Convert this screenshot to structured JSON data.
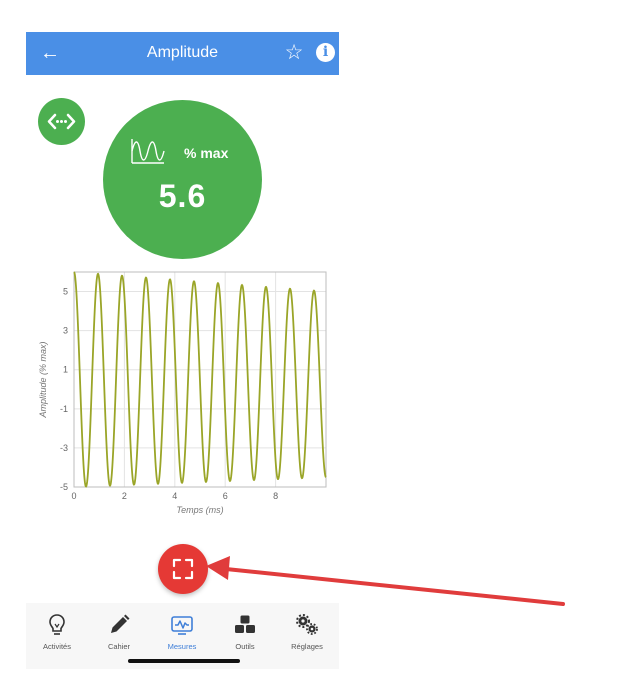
{
  "appbar": {
    "title": "Amplitude",
    "back_icon": "arrow-left-icon",
    "favorite_icon": "star-outline-icon",
    "info_icon": "info-icon",
    "color": "#4a8fe6"
  },
  "gauge": {
    "unit": "% max",
    "value": "5.6",
    "icon": "waveform-icon",
    "color": "#4caf50"
  },
  "toggle_button": {
    "icon": "code-arrows-icon"
  },
  "chart_data": {
    "type": "line",
    "xlabel": "Temps (ms)",
    "ylabel": "Amplitude (% max)",
    "xlim": [
      0,
      10
    ],
    "ylim": [
      -5,
      6
    ],
    "xticks": [
      "0",
      "2",
      "4",
      "6",
      "8"
    ],
    "yticks": [
      "5",
      "3",
      "1",
      "-1",
      "-3",
      "-5"
    ],
    "grid": true,
    "series": [
      {
        "frequency_khz": 1.05,
        "peak_start": 6.0,
        "peak_end": 5.0,
        "trough_start": -5.0,
        "trough_end": -4.5,
        "color": "#9aa528"
      }
    ]
  },
  "fab": {
    "icon": "fullscreen-icon",
    "color": "#e53935"
  },
  "tabs": [
    {
      "label": "Activités",
      "icon": "lightbulb-icon",
      "active": false
    },
    {
      "label": "Cahier",
      "icon": "pencil-icon",
      "active": false
    },
    {
      "label": "Mesures",
      "icon": "monitor-wave-icon",
      "active": true
    },
    {
      "label": "Outils",
      "icon": "cubes-icon",
      "active": false
    },
    {
      "label": "Réglages",
      "icon": "gears-icon",
      "active": false
    }
  ],
  "annotation": {
    "arrow_color": "#e03c3c"
  }
}
